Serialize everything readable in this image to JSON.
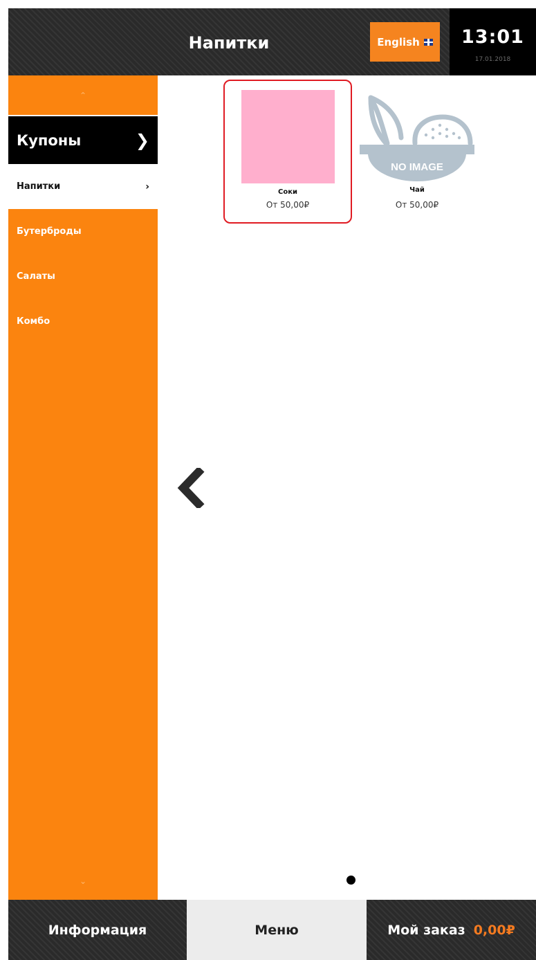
{
  "header": {
    "title": "Напитки",
    "language_button": "English",
    "time": "13:01",
    "date": "17.01.2018"
  },
  "sidebar": {
    "coupons_label": "Купоны",
    "items": [
      {
        "label": "Напитки",
        "active": true
      },
      {
        "label": "Бутерброды",
        "active": false
      },
      {
        "label": "Салаты",
        "active": false
      },
      {
        "label": "Комбо",
        "active": false
      }
    ]
  },
  "products": [
    {
      "name": "Соки",
      "price": "От 50,00₽",
      "selected": true,
      "image_color": "#ffafcd"
    },
    {
      "name": "Чай",
      "price": "От 50,00₽",
      "selected": false,
      "placeholder_text": "NO IMAGE"
    }
  ],
  "footer": {
    "info_label": "Информация",
    "menu_label": "Меню",
    "order_label": "Мой заказ",
    "order_amount": "0,00₽"
  },
  "colors": {
    "accent": "#fb840f",
    "selected_border": "#e01a22",
    "order_amount": "#f47a20"
  }
}
